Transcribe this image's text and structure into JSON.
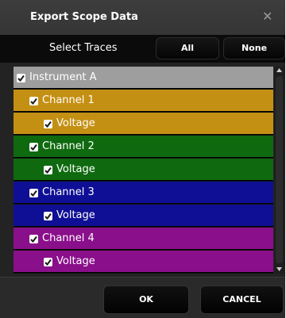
{
  "dialog": {
    "title": "Export Scope Data",
    "close_glyph": "✕"
  },
  "select_bar": {
    "label": "Select Traces",
    "all_label": "All",
    "none_label": "None"
  },
  "traces": [
    {
      "label": "Instrument A",
      "level": 0,
      "checked": true,
      "color": "#9e9e9e"
    },
    {
      "label": "Channel 1",
      "level": 1,
      "checked": true,
      "color": "#c49013"
    },
    {
      "label": "Voltage",
      "level": 2,
      "checked": true,
      "color": "#c49013"
    },
    {
      "label": "Channel 2",
      "level": 1,
      "checked": true,
      "color": "#0f6a0f"
    },
    {
      "label": "Voltage",
      "level": 2,
      "checked": true,
      "color": "#0f6a0f"
    },
    {
      "label": "Channel 3",
      "level": 1,
      "checked": true,
      "color": "#0f0f96"
    },
    {
      "label": "Voltage",
      "level": 2,
      "checked": true,
      "color": "#0f0f96"
    },
    {
      "label": "Channel 4",
      "level": 1,
      "checked": true,
      "color": "#8a0f8a"
    },
    {
      "label": "Voltage",
      "level": 2,
      "checked": true,
      "color": "#8a0f8a"
    }
  ],
  "footer": {
    "ok_label": "OK",
    "cancel_label": "CANCEL"
  }
}
